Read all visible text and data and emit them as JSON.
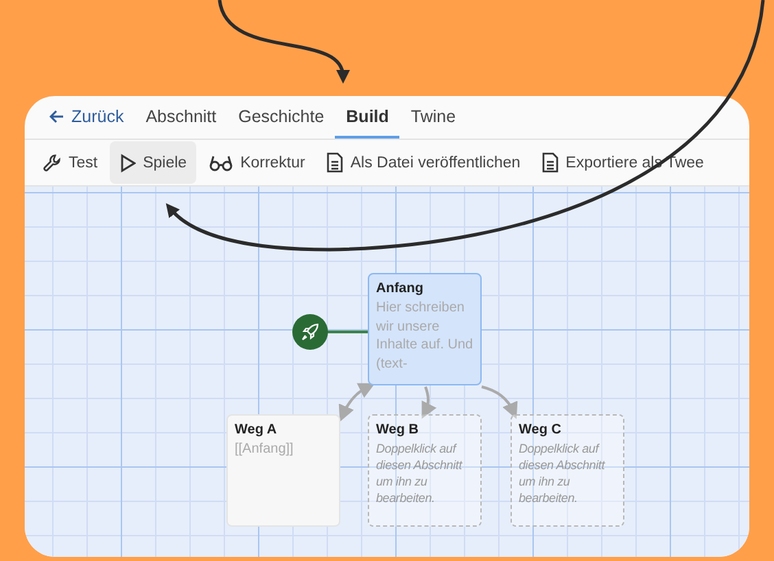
{
  "nav": {
    "back": "Zurück",
    "tabs": [
      {
        "label": "Abschnitt",
        "selected": false
      },
      {
        "label": "Geschichte",
        "selected": false
      },
      {
        "label": "Build",
        "selected": true
      },
      {
        "label": "Twine",
        "selected": false
      }
    ]
  },
  "toolbar": [
    {
      "kind": "wrench",
      "label": "Test",
      "active": false
    },
    {
      "kind": "play",
      "label": "Spiele",
      "active": true
    },
    {
      "kind": "glasses",
      "label": "Korrektur",
      "active": false
    },
    {
      "kind": "document",
      "label": "Als Datei veröffentlichen",
      "active": false
    },
    {
      "kind": "document",
      "label": "Exportiere als Twee",
      "active": false
    }
  ],
  "passages": [
    {
      "title": "Anfang",
      "excerpt": "Hier schreiben wir unsere Inhalte auf. Und (text-",
      "start": true,
      "selected": true,
      "empty": false
    },
    {
      "title": "Weg A",
      "excerpt": "[[Anfang]]",
      "start": false,
      "selected": false,
      "empty": false
    },
    {
      "title": "Weg B",
      "excerpt": "Doppelklick auf diesen Abschnitt um ihn zu bearbeiten.",
      "start": false,
      "selected": false,
      "empty": true
    },
    {
      "title": "Weg C",
      "excerpt": "Doppelklick auf diesen Abschnitt um ihn zu bearbeiten.",
      "start": false,
      "selected": false,
      "empty": true
    }
  ]
}
